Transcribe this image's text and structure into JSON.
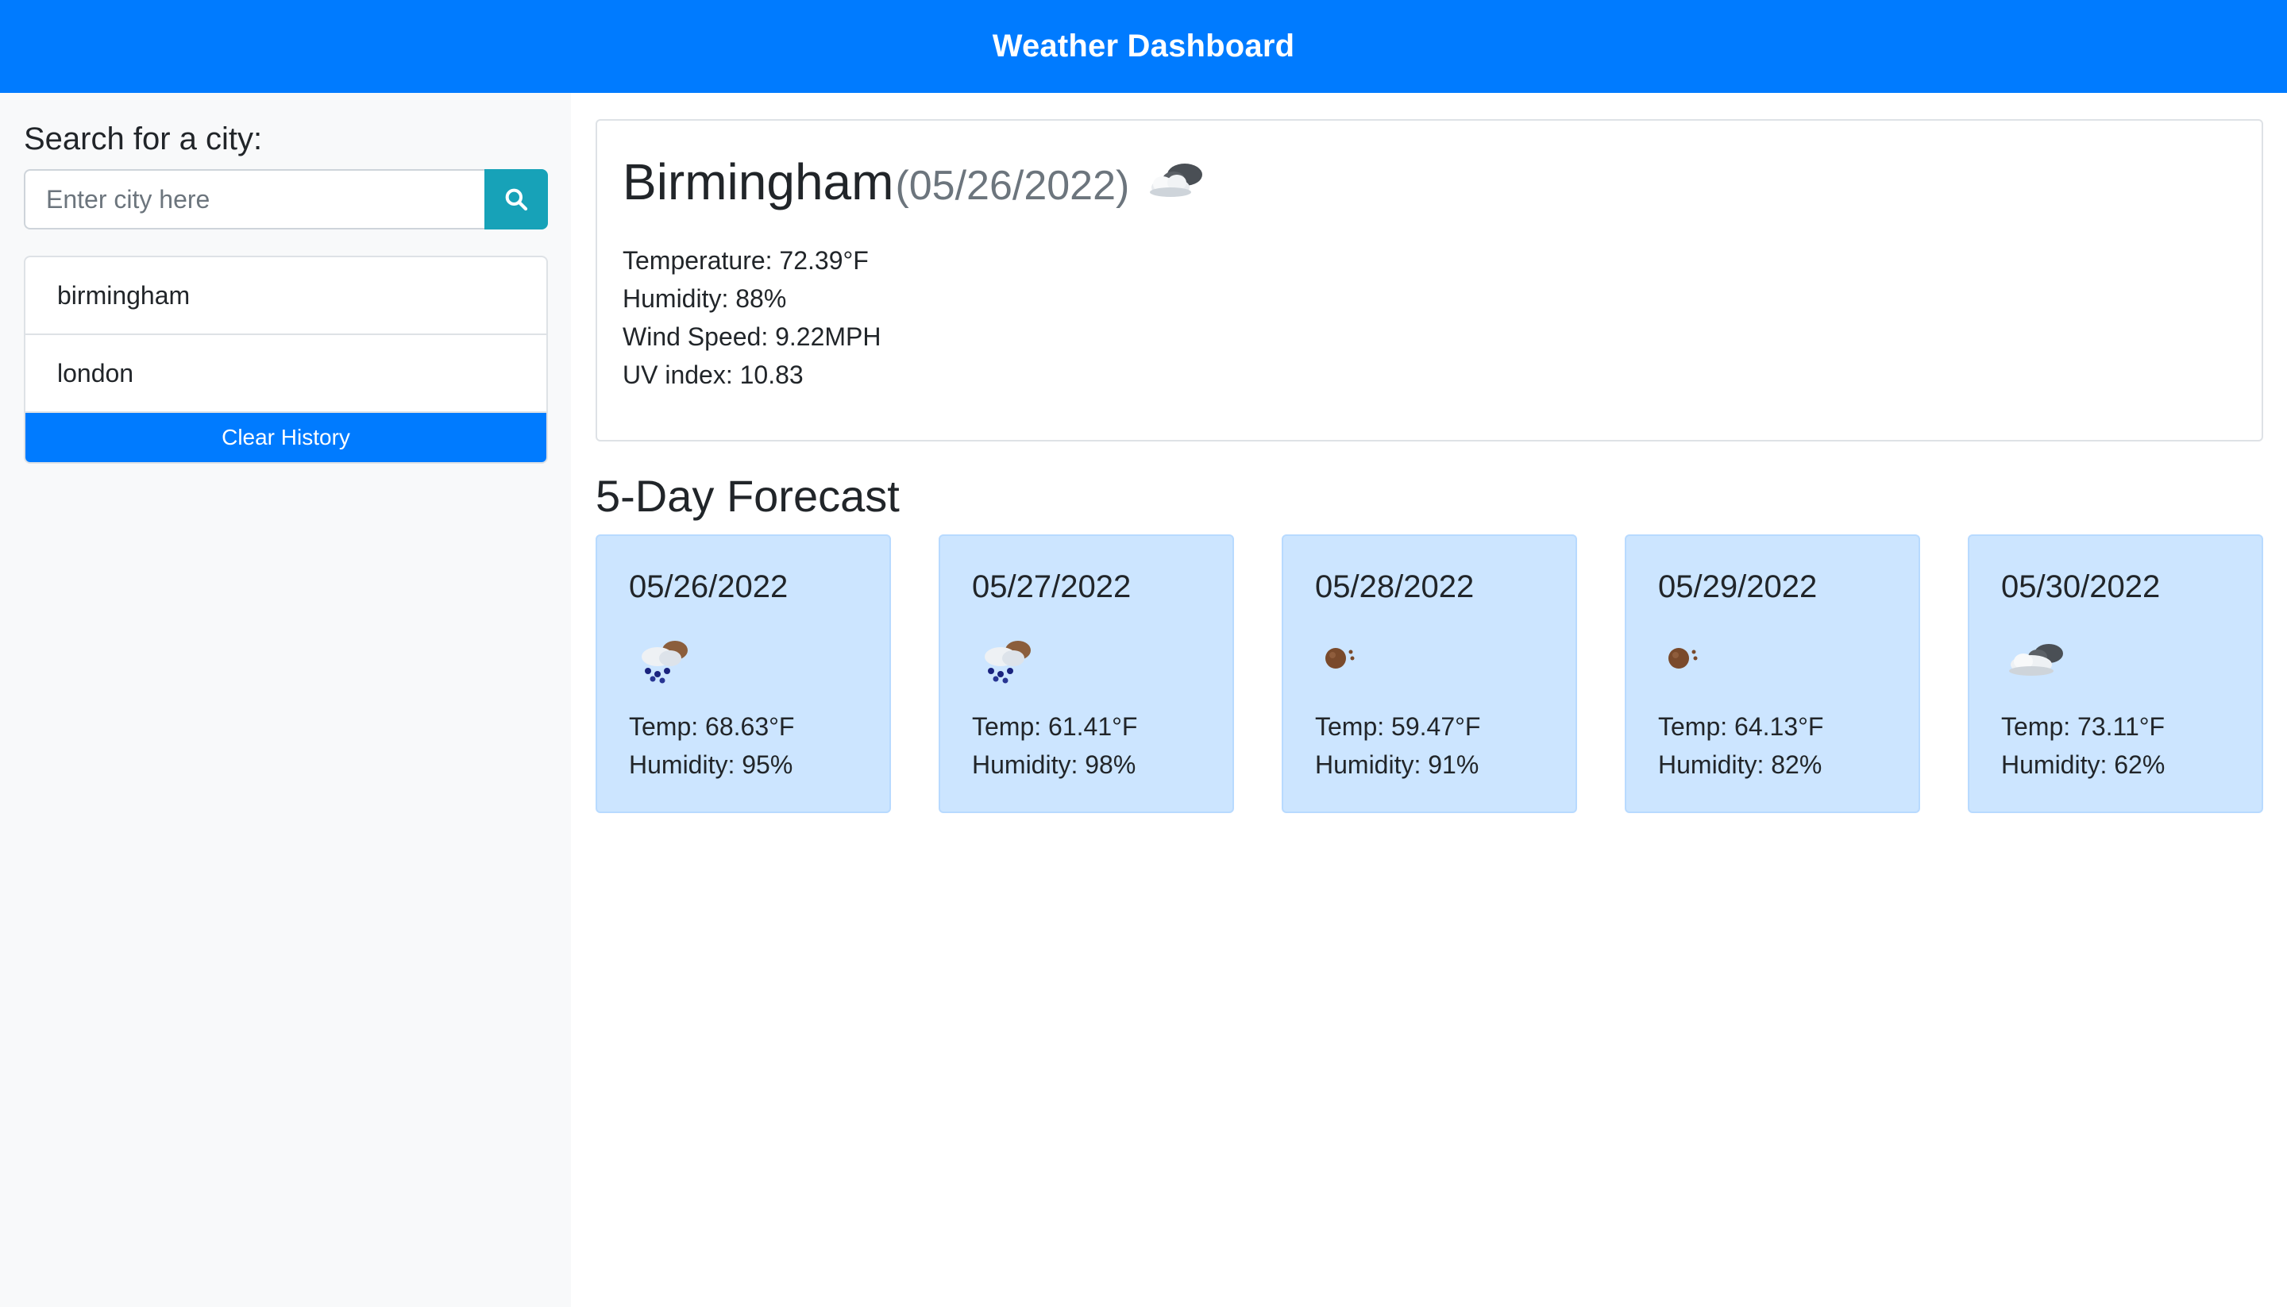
{
  "header": {
    "title": "Weather Dashboard"
  },
  "sidebar": {
    "search_label": "Search for a city:",
    "search_placeholder": "Enter city here",
    "search_value": "",
    "history": [
      "birmingham",
      "london"
    ],
    "clear_label": "Clear History"
  },
  "current": {
    "city": "Birmingham",
    "date": "(05/26/2022)",
    "icon": "broken-clouds-icon",
    "temperature": "Temperature: 72.39°F",
    "humidity": "Humidity: 88%",
    "wind": "Wind Speed: 9.22MPH",
    "uv": "UV index: 10.83"
  },
  "forecast": {
    "title": "5-Day Forecast",
    "days": [
      {
        "date": "05/26/2022",
        "icon": "rain-icon",
        "temp": "Temp: 68.63°F",
        "humidity": "Humidity: 95%"
      },
      {
        "date": "05/27/2022",
        "icon": "rain-icon",
        "temp": "Temp: 61.41°F",
        "humidity": "Humidity: 98%"
      },
      {
        "date": "05/28/2022",
        "icon": "clear-sky-icon",
        "temp": "Temp: 59.47°F",
        "humidity": "Humidity: 91%"
      },
      {
        "date": "05/29/2022",
        "icon": "clear-sky-icon",
        "temp": "Temp: 64.13°F",
        "humidity": "Humidity: 82%"
      },
      {
        "date": "05/30/2022",
        "icon": "broken-clouds-icon",
        "temp": "Temp: 73.11°F",
        "humidity": "Humidity: 62%"
      }
    ]
  },
  "colors": {
    "primary": "#007bff",
    "info": "#17a2b8",
    "card_bg": "#cce5ff",
    "sidebar_bg": "#f8f9fa"
  }
}
